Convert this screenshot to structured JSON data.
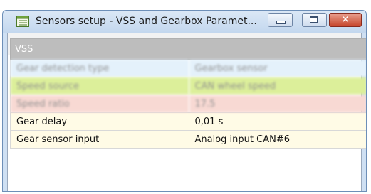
{
  "window": {
    "title": "Sensors setup - VSS and Gearbox Paramet...",
    "close_glyph": "✕"
  },
  "toolbar": {
    "icons": [
      "folder-open-icon",
      "save-icon",
      "window-icon",
      "help-icon"
    ]
  },
  "table": {
    "section": "VSS",
    "rows": [
      {
        "name": "Gear detection type",
        "value": "Gearbox sensor",
        "color": "#e4f1fb"
      },
      {
        "name": "Speed source",
        "value": "CAN wheel speed",
        "color": "#dcef9a"
      },
      {
        "name": "Speed ratio",
        "value": "17.5",
        "color": "#f8d9d3"
      },
      {
        "name": "Gear delay",
        "value": "0,01 s",
        "color": "#fffbe6"
      },
      {
        "name": "Gear sensor input",
        "value": "Analog input CAN#6",
        "color": "#fffbe6"
      }
    ]
  },
  "colors": {
    "titlebar": "#c3d7ee",
    "close_button": "#c6452b",
    "header_row": "#bdbdbd"
  }
}
